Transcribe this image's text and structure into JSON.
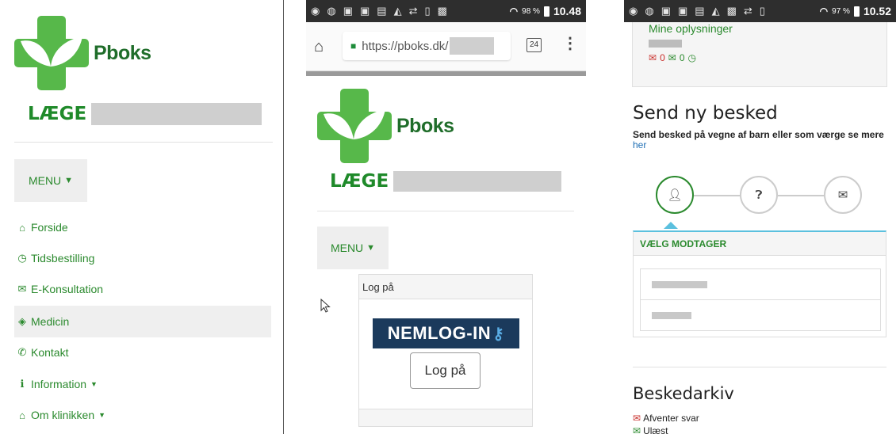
{
  "colors": {
    "brand_green": "#2b8a2e",
    "logo_green": "#57b84a",
    "nemlog_blue": "#1b3a5c",
    "info_blue": "#5bc0de"
  },
  "left_panel": {
    "logo_text": "Pboks",
    "clinic_prefix": "LÆGE",
    "menu_label": "MENU",
    "nav": [
      {
        "label": "Forside",
        "icon": "home-icon",
        "glyph": "🏠︎"
      },
      {
        "label": "Tidsbestilling",
        "icon": "clock-icon",
        "glyph": "◷"
      },
      {
        "label": "E-Konsultation",
        "icon": "envelope-icon",
        "glyph": "✉"
      },
      {
        "label": "Medicin",
        "icon": "tag-icon",
        "glyph": "⬢"
      },
      {
        "label": "Kontakt",
        "icon": "phone-icon",
        "glyph": "✆"
      },
      {
        "label": "Information",
        "icon": "info-icon",
        "glyph": "ℹ"
      },
      {
        "label": "Om klinikken",
        "icon": "home-icon",
        "glyph": "🏠︎"
      }
    ]
  },
  "middle_panel": {
    "status": {
      "battery": "98 %",
      "time": "10.48"
    },
    "browser": {
      "url": "https://pboks.dk/",
      "tab_count": "24"
    },
    "logo_text": "Pboks",
    "clinic_prefix": "LÆGE",
    "menu_label": "MENU",
    "login": {
      "header": "Log på",
      "nemlog_text": "NEMLOG-IN",
      "button": "Log på"
    }
  },
  "right_panel": {
    "status": {
      "battery": "97 %",
      "time": "10.52"
    },
    "info_title": "Mine oplysninger",
    "counts": {
      "unread": "0",
      "read": "0"
    },
    "send_heading": "Send ny besked",
    "send_desc": "Send besked på vegne af barn eller som værge se mere",
    "send_link": "her",
    "recipient_header": "VÆLG MODTAGER",
    "archive_heading": "Beskedarkiv",
    "archive_items": [
      "Afventer svar",
      "Ulæst"
    ]
  }
}
